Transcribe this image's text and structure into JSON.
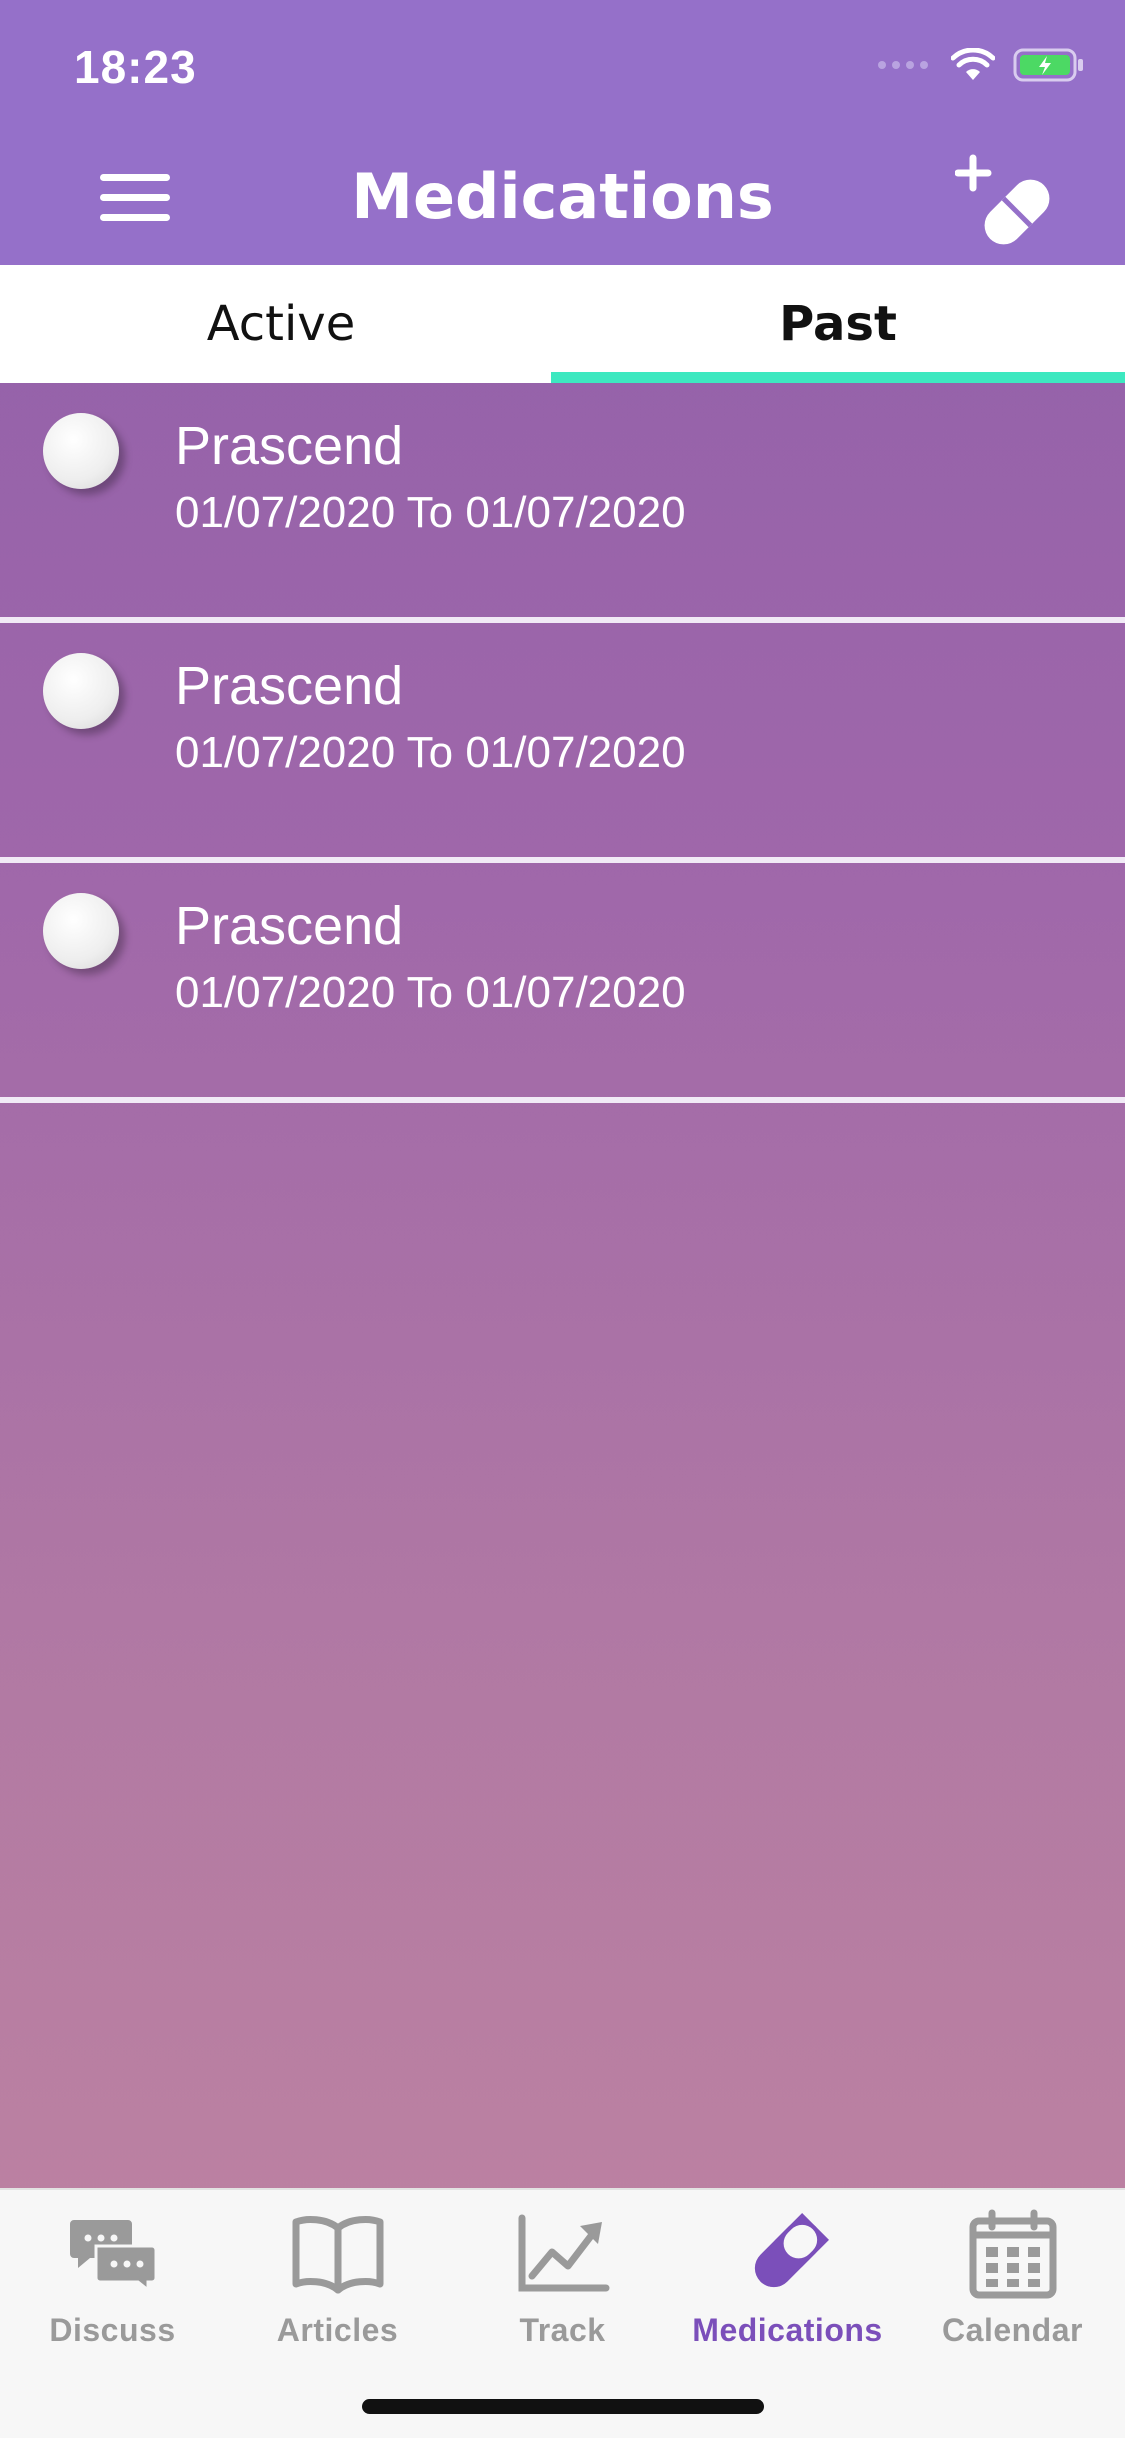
{
  "status_bar": {
    "time": "18:23"
  },
  "header": {
    "title": "Medications"
  },
  "tabs": [
    {
      "label": "Active",
      "active": false
    },
    {
      "label": "Past",
      "active": true
    }
  ],
  "medications": [
    {
      "name": "Prascend",
      "dates": "01/07/2020 To 01/07/2020"
    },
    {
      "name": "Prascend",
      "dates": "01/07/2020 To 01/07/2020"
    },
    {
      "name": "Prascend",
      "dates": "01/07/2020 To 01/07/2020"
    }
  ],
  "tab_bar": [
    {
      "label": "Discuss",
      "icon": "chat-bubbles-icon",
      "selected": false
    },
    {
      "label": "Articles",
      "icon": "open-book-icon",
      "selected": false
    },
    {
      "label": "Track",
      "icon": "line-chart-icon",
      "selected": false
    },
    {
      "label": "Medications",
      "icon": "pill-icon",
      "selected": true
    },
    {
      "label": "Calendar",
      "icon": "calendar-icon",
      "selected": false
    }
  ],
  "colors": {
    "header": "#9570c9",
    "accent": "#3de8c0",
    "selected_tab": "#7b4fba",
    "inactive_tab": "#9a9a9a"
  }
}
